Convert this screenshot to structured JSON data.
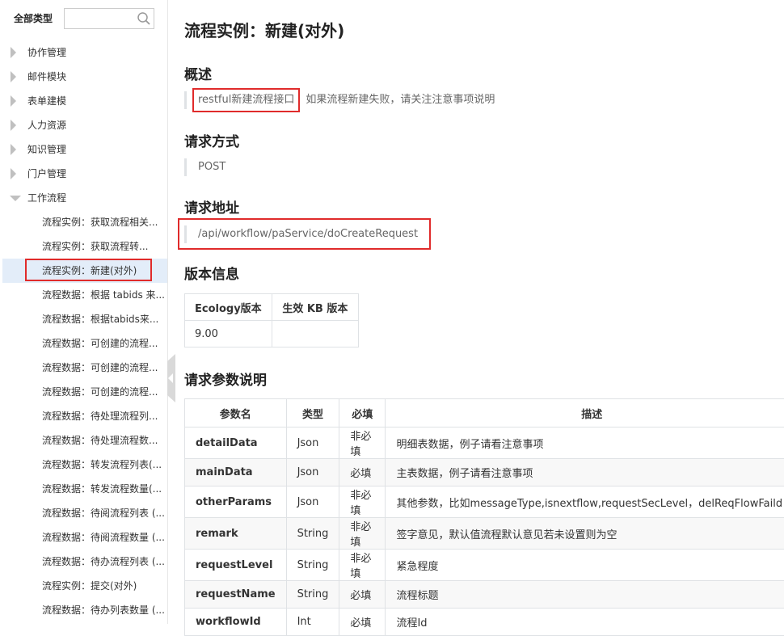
{
  "sidebar": {
    "all_types": "全部类型",
    "search_placeholder": "",
    "categories": [
      {
        "label": "协作管理",
        "expanded": false
      },
      {
        "label": "邮件模块",
        "expanded": false
      },
      {
        "label": "表单建模",
        "expanded": false
      },
      {
        "label": "人力资源",
        "expanded": false
      },
      {
        "label": "知识管理",
        "expanded": false
      },
      {
        "label": "门户管理",
        "expanded": false
      },
      {
        "label": "工作流程",
        "expanded": true
      }
    ],
    "workflow_items": [
      "流程实例：获取流程相关...",
      "流程实例：获取流程转...",
      "流程实例：新建(对外)",
      "流程数据：根据 tabids 来...",
      "流程数据：根据tabids来...",
      "流程数据：可创建的流程...",
      "流程数据：可创建的流程...",
      "流程数据：可创建的流程...",
      "流程数据：待处理流程列...",
      "流程数据：待处理流程数...",
      "流程数据：转发流程列表(...",
      "流程数据：转发流程数量(...",
      "流程数据：待阅流程列表 (...",
      "流程数据：待阅流程数量 (...",
      "流程数据：待办流程列表 (...",
      "流程实例：提交(对外)",
      "流程数据：待办列表数量 (..."
    ],
    "active_index": 2
  },
  "main": {
    "title": "流程实例：新建(对外)",
    "overview": {
      "heading": "概述",
      "highlight": "restful新建流程接口",
      "note": "如果流程新建失败，请关注注意事项说明"
    },
    "method": {
      "heading": "请求方式",
      "value": "POST"
    },
    "address": {
      "heading": "请求地址",
      "value": "/api/workflow/paService/doCreateRequest"
    },
    "version": {
      "heading": "版本信息",
      "headers": [
        "Ecology版本",
        "生效 KB 版本"
      ],
      "row": [
        "9.00",
        ""
      ]
    },
    "params": {
      "heading": "请求参数说明",
      "headers": [
        "参数名",
        "类型",
        "必填",
        "描述"
      ],
      "rows": [
        [
          "detailData",
          "Json",
          "非必填",
          "明细表数据，例子请看注意事项"
        ],
        [
          "mainData",
          "Json",
          "必填",
          "主表数据，例子请看注意事项"
        ],
        [
          "otherParams",
          "Json",
          "非必填",
          "其他参数，比如messageType,isnextflow,requestSecLevel，delReqFlowFaild"
        ],
        [
          "remark",
          "String",
          "非必填",
          "签字意见，默认值流程默认意见若未设置则为空"
        ],
        [
          "requestLevel",
          "String",
          "非必填",
          "紧急程度"
        ],
        [
          "requestName",
          "String",
          "必填",
          "流程标题"
        ],
        [
          "workflowId",
          "Int",
          "必填",
          "流程Id"
        ]
      ]
    }
  },
  "colors": {
    "highlight_border": "#e02b2b",
    "active_bg": "#e3edf9"
  }
}
